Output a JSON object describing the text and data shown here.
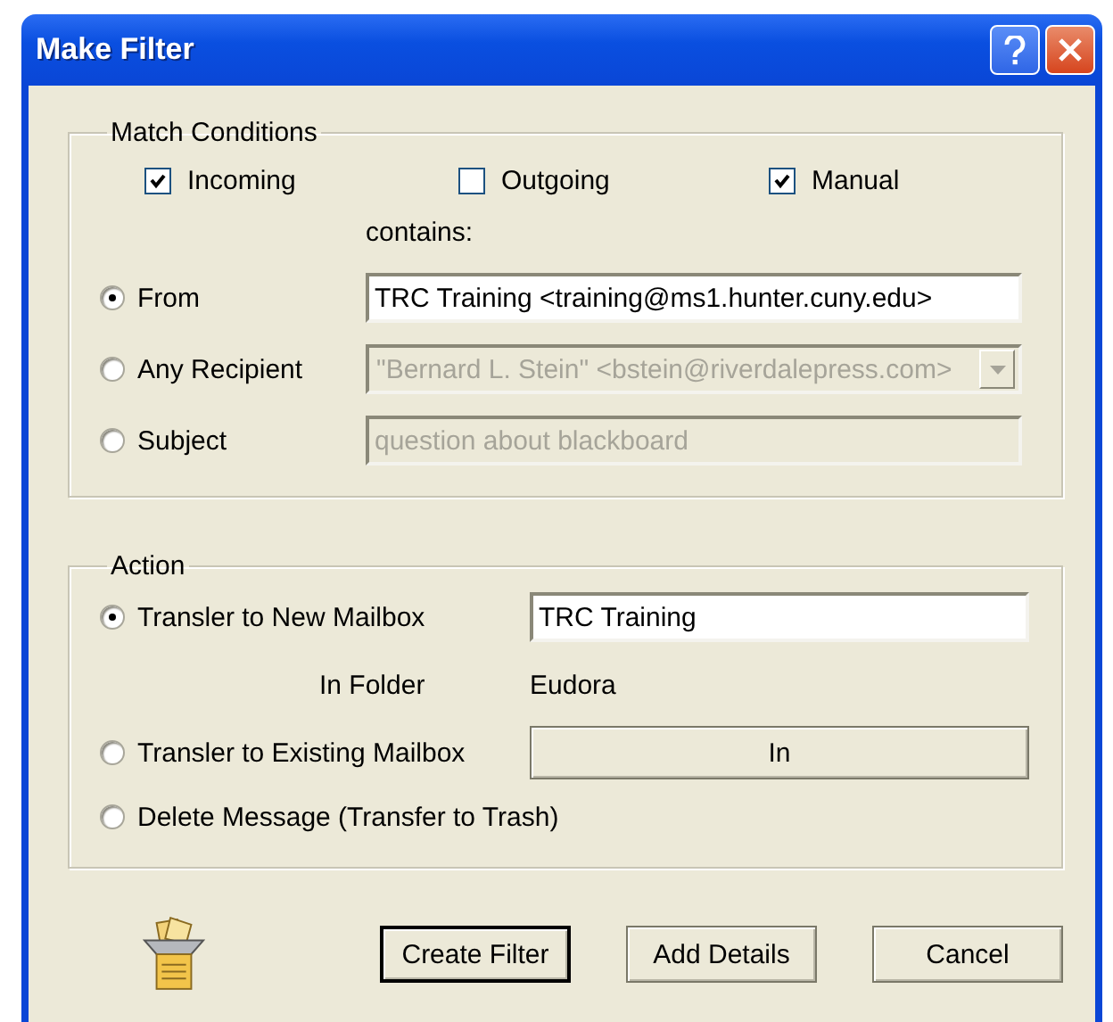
{
  "window": {
    "title": "Make Filter"
  },
  "match_conditions": {
    "title": "Match Conditions",
    "checkboxes": [
      {
        "label": "Incoming",
        "checked": true
      },
      {
        "label": "Outgoing",
        "checked": false
      },
      {
        "label": "Manual",
        "checked": true
      }
    ],
    "contains_label": "contains:",
    "criteria": [
      {
        "label": "From",
        "selected": true,
        "kind": "text",
        "value": "TRC Training <training@ms1.hunter.cuny.edu>",
        "disabled": false
      },
      {
        "label": "Any Recipient",
        "selected": false,
        "kind": "dropdown",
        "value": "\"Bernard L. Stein\" <bstein@riverdalepress.com>",
        "disabled": true
      },
      {
        "label": "Subject",
        "selected": false,
        "kind": "text",
        "value": "question about blackboard",
        "disabled": true
      }
    ]
  },
  "action": {
    "title": "Action",
    "options": [
      {
        "label": "Transler to New Mailbox",
        "selected": true,
        "kind": "text",
        "value": "TRC Training"
      },
      {
        "label": "Transler to Existing Mailbox",
        "selected": false,
        "kind": "button",
        "value": "In"
      },
      {
        "label": "Delete Message (Transfer to Trash)",
        "selected": false,
        "kind": "none"
      }
    ],
    "folder": {
      "label": "In Folder",
      "value": "Eudora"
    }
  },
  "buttons": [
    {
      "label": "Create Filter",
      "default": true
    },
    {
      "label": "Add Details",
      "default": false
    },
    {
      "label": "Cancel",
      "default": false
    }
  ]
}
